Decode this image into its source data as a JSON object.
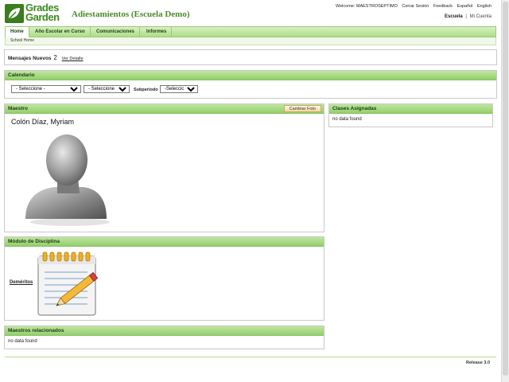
{
  "header": {
    "logo_top": "Grades",
    "logo_bottom": "Garden",
    "app_title": "Adiestamientos (Escuela Demo)",
    "welcome": "Welcome: MAESTROSEPTIMO",
    "links": [
      "Cerrar Sesión",
      "Feedback",
      "Español",
      "English"
    ],
    "account_school": "Escuela",
    "account_sep": "|",
    "account_mine": "Mi Cuenta"
  },
  "nav": {
    "tabs": [
      "Home",
      "Año Escolar en Curso",
      "Comunicaciones",
      "Informes"
    ],
    "active": "Home",
    "subnav": "School Home"
  },
  "messages": {
    "label": "Mensajes Nuevos",
    "count": "2",
    "link": "Ver Detalle"
  },
  "calendar": {
    "title": "Calendario",
    "select1": "- Seleccione -",
    "select2": "- Seleccione -",
    "subperiodo_label": "Subperiodo",
    "select3": "-Seleccione -"
  },
  "maestro": {
    "title": "Maestro",
    "photo_button": "Cambiar Foto",
    "name": "Colón Díaz, Myriam"
  },
  "clases": {
    "title": "Clases Asignadas",
    "empty": "no data found"
  },
  "disciplina": {
    "title": "Módulo de Disciplina",
    "link": "Deméritos"
  },
  "relacionados": {
    "title": "Maestros relacionados",
    "empty": "no data found"
  },
  "footer": {
    "release": "Release 3.0"
  },
  "colors": {
    "brand_green": "#3d8a1e",
    "panel_header": "#93cf6c",
    "nav": "#aedd8a"
  }
}
